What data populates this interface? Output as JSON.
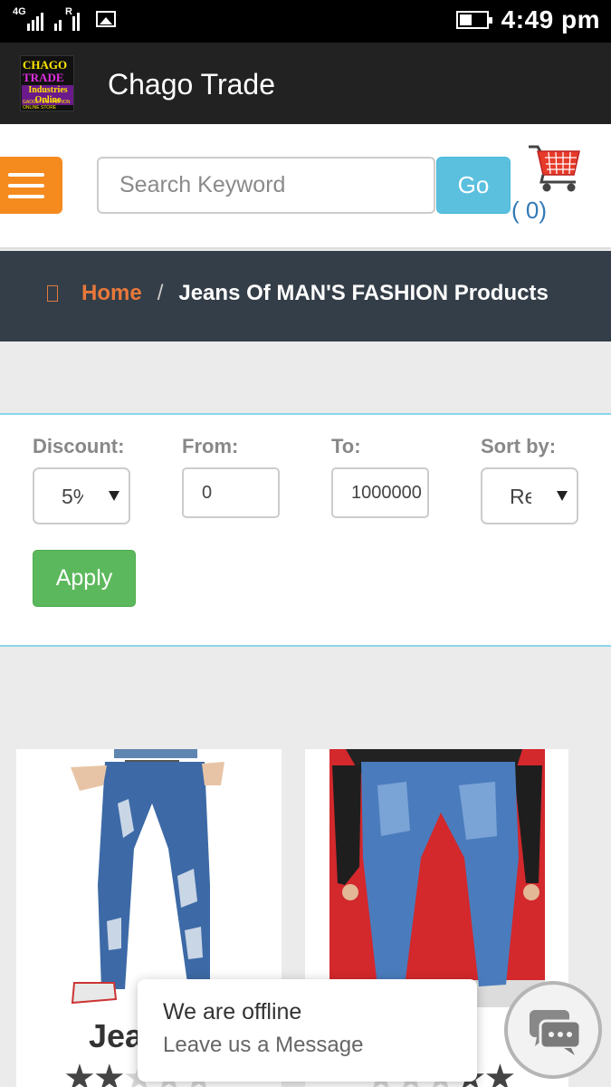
{
  "status_bar": {
    "network_1": "4G",
    "network_2": "R",
    "time": "4:49 pm",
    "battery_level": 0.45,
    "icons": [
      "signal-icon",
      "roaming-signal-icon",
      "gallery-icon",
      "battery-icon"
    ]
  },
  "app_bar": {
    "title": "Chago Trade",
    "logo": {
      "line1a": "CHAGO",
      "line1b": "TRADE",
      "line2": "Industries Online",
      "line3": "GADGETS & FASHION ONLINE STORE"
    }
  },
  "header": {
    "search_placeholder": "Search Keyword",
    "go_label": "Go",
    "cart_count": "( 0)",
    "menu_icon": "hamburger-icon",
    "cart_icon": "shopping-cart-icon",
    "colors": {
      "menu": "#f58a1f",
      "go": "#5bc0de",
      "cart_count": "#337ab7"
    }
  },
  "breadcrumb": {
    "home_icon": "home-icon",
    "home": "Home",
    "separator": "/",
    "current": "Jeans Of MAN'S FASHION Products"
  },
  "filters": {
    "discount_label": "Discount:",
    "discount_value": "5%",
    "from_label": "From:",
    "from_value": "0",
    "to_label": "To:",
    "to_value": "1000000",
    "sort_label": "Sort by:",
    "sort_value": "Re",
    "apply_label": "Apply"
  },
  "products": [
    {
      "title": "Jea",
      "rating": 2
    },
    {
      "title": "",
      "rating": 2
    }
  ],
  "chat": {
    "line1": "We are offline",
    "line2": "Leave us a Message",
    "icon": "chat-bubbles-icon"
  }
}
